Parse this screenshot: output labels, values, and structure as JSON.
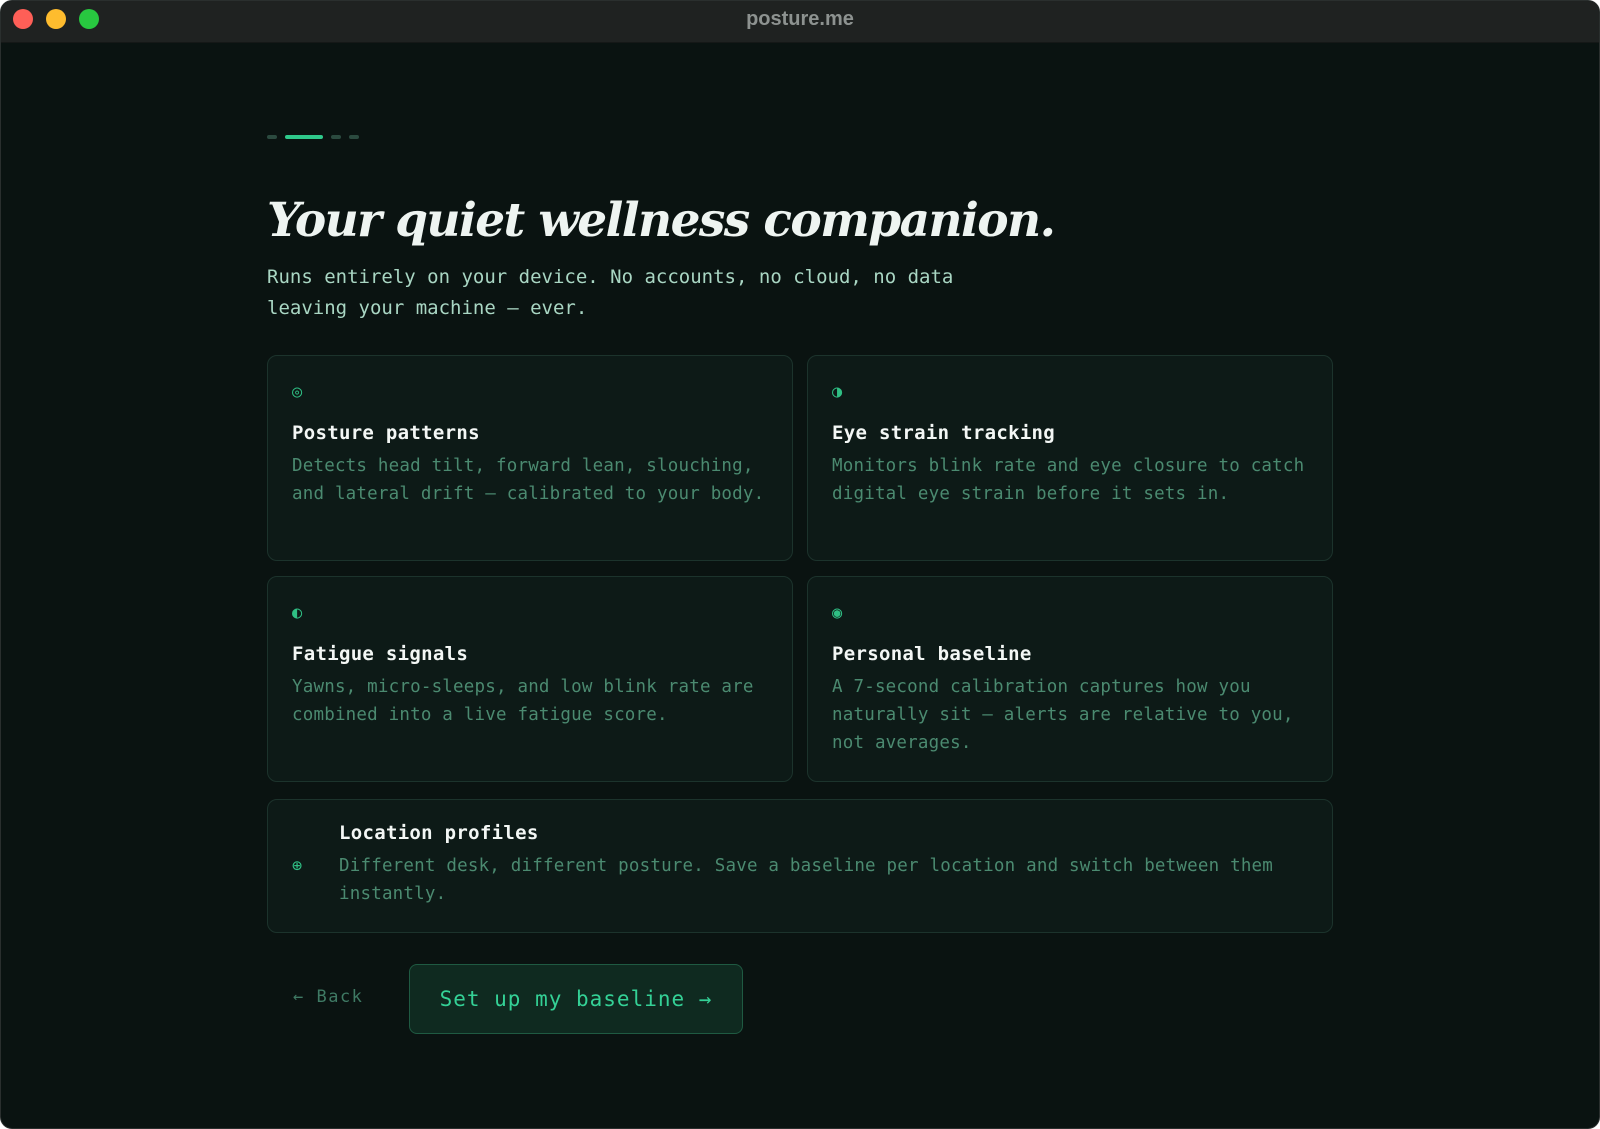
{
  "window": {
    "title": "posture.me"
  },
  "onboarding": {
    "steps": [
      {
        "state": "inactive"
      },
      {
        "state": "active"
      },
      {
        "state": "inactive"
      },
      {
        "state": "inactive"
      }
    ],
    "headline": "Your quiet wellness companion.",
    "subtitle": "Runs entirely on your device. No accounts, no cloud, no data leaving your machine — ever."
  },
  "features": [
    {
      "icon": "◎",
      "icon_name": "target-icon",
      "title": "Posture patterns",
      "description": "Detects head tilt, forward lean, slouching, and lateral drift — calibrated to your body."
    },
    {
      "icon": "◑",
      "icon_name": "half-circle-right-icon",
      "title": "Eye strain tracking",
      "description": "Monitors blink rate and eye closure to catch digital eye strain before it sets in."
    },
    {
      "icon": "◐",
      "icon_name": "half-circle-left-icon",
      "title": "Fatigue signals",
      "description": "Yawns, micro-sleeps, and low blink rate are combined into a live fatigue score."
    },
    {
      "icon": "◉",
      "icon_name": "bullseye-icon",
      "title": "Personal baseline",
      "description": "A 7-second calibration captures how you naturally sit — alerts are relative to you, not averages."
    },
    {
      "icon": "⊕",
      "icon_name": "circled-plus-icon",
      "title": "Location profiles",
      "description": "Different desk, different posture. Save a baseline per location and switch between them instantly."
    }
  ],
  "actions": {
    "back_label": "← Back",
    "primary_label": "Set up my baseline →"
  },
  "colors": {
    "background": "#0a1311",
    "accent": "#2fc98b",
    "card": "#0d1a17"
  }
}
